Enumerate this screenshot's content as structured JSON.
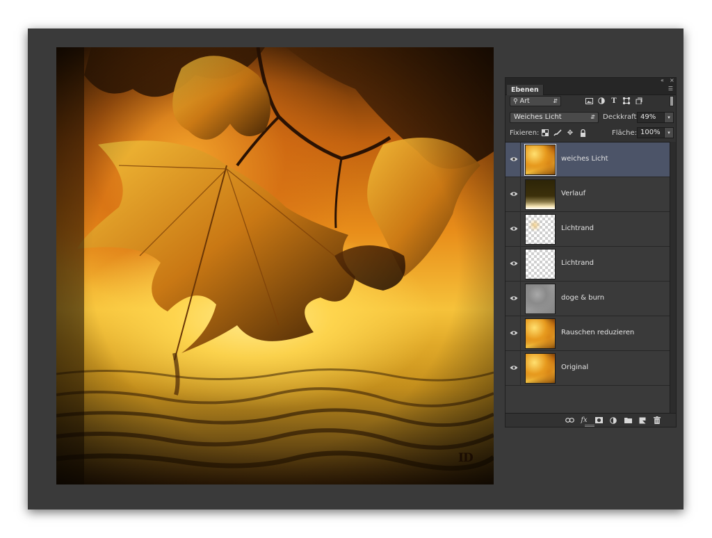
{
  "canvas": {
    "signature": "ID"
  },
  "panel": {
    "title": "Ebenen",
    "filter": {
      "label": "Art"
    },
    "blend_mode": "Weiches Licht",
    "opacity_label": "Deckkraft:",
    "opacity_value": "49%",
    "lock_label": "Fixieren:",
    "fill_label": "Fläche:",
    "fill_value": "100%"
  },
  "layers": [
    {
      "name": "weiches Licht",
      "thumb": "leaf",
      "selected": true
    },
    {
      "name": "Verlauf",
      "thumb": "verlauf",
      "selected": false
    },
    {
      "name": "Lichtrand",
      "thumb": "checker",
      "selected": false
    },
    {
      "name": "Lichtrand",
      "thumb": "checker",
      "selected": false
    },
    {
      "name": "doge & burn",
      "thumb": "gray",
      "selected": false
    },
    {
      "name": "Rauschen reduzieren",
      "thumb": "leaf",
      "selected": false
    },
    {
      "name": "Original",
      "thumb": "leaf",
      "selected": false
    }
  ],
  "icons": {
    "filter_icons": [
      "image-filter-icon",
      "adjustment-filter-icon",
      "type-filter-icon",
      "shape-filter-icon",
      "smart-object-filter-icon"
    ],
    "lock_icons": [
      "lock-transparent-pixels-icon",
      "lock-image-pixels-icon",
      "lock-position-icon",
      "lock-all-icon"
    ],
    "bottom_icons": [
      "link-layers-icon",
      "fx-icon",
      "add-mask-icon",
      "new-adjustment-layer-icon",
      "new-group-icon",
      "new-layer-icon",
      "delete-layer-icon"
    ]
  }
}
